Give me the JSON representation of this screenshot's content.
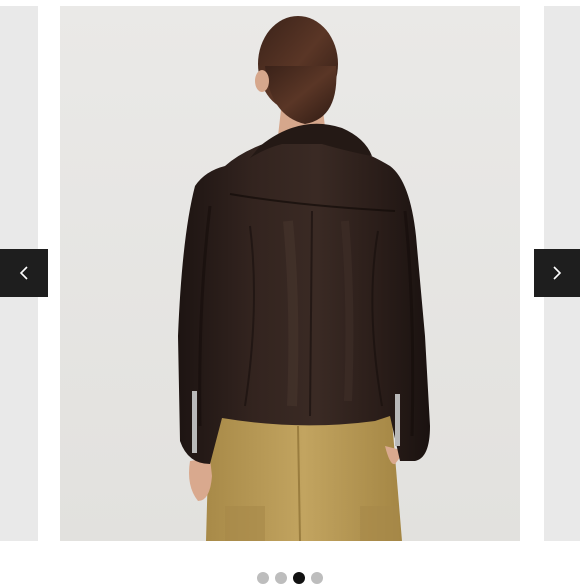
{
  "carousel": {
    "image": {
      "subject": "woman-wearing-leather-jacket-back-view",
      "background_color": "#e7e6e4",
      "jacket_color": "#2b1f1c",
      "pants_color": "#b89a55",
      "hair_color": "#4a2c20"
    },
    "nav": {
      "prev_icon": "chevron-left-icon",
      "next_icon": "chevron-right-icon",
      "button_color": "#1e1e1e"
    },
    "pagination": {
      "total": 4,
      "current": 3,
      "dot_color": "#bdbdbd",
      "active_color": "#111111"
    }
  }
}
